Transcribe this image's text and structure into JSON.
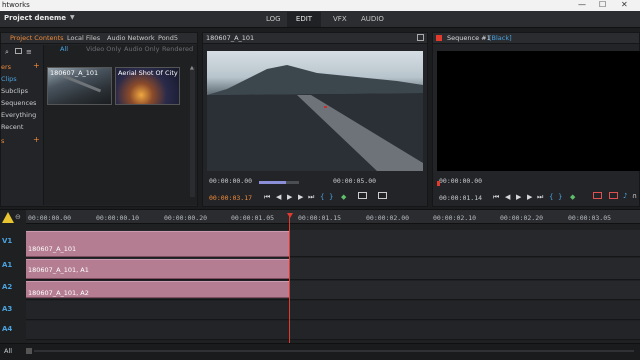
{
  "window": {
    "title": "htworks",
    "controls": [
      "—",
      "☐",
      "✕"
    ]
  },
  "menubar": {
    "project": "Project deneme",
    "project_dropdown": "▼",
    "tabs": [
      {
        "label": "LOG"
      },
      {
        "label": "EDIT"
      },
      {
        "label": "VFX"
      },
      {
        "label": "AUDIO"
      }
    ],
    "active_tab": "EDIT"
  },
  "project_panel": {
    "tabs": [
      {
        "label": "Project Contents"
      },
      {
        "label": "Local Files"
      },
      {
        "label": "Audio Network"
      },
      {
        "label": "Pond5"
      }
    ],
    "sidebar": [
      {
        "label": "ers",
        "plus": "+"
      },
      {
        "label": "Clips"
      },
      {
        "label": "Subclips"
      },
      {
        "label": "Sequences"
      },
      {
        "label": "Everything"
      },
      {
        "label": "Recent"
      },
      {
        "label": "s",
        "plus": "+"
      }
    ],
    "filters": [
      {
        "label": "All"
      },
      {
        "label": "Video Only"
      },
      {
        "label": "Audio Only"
      },
      {
        "label": "Rendered"
      }
    ],
    "thumbs": [
      {
        "label": "180607_A_101"
      },
      {
        "label": "Aerial Shot Of City"
      }
    ]
  },
  "source_viewer": {
    "title": "180607_A_101",
    "tc_in": "00:00:00.00",
    "tc_out": "00:00:05.00",
    "tc_current": "00:00:03.17",
    "playhead_position": 0.68
  },
  "sequence_viewer": {
    "title": "Sequence #1",
    "subtitle": "[Black]",
    "tc_in": "00:00:00.00",
    "tc_current": "00:00:01.14"
  },
  "timeline": {
    "ruler": [
      "00:00:00.00",
      "00:00:00.10",
      "00:00:00.20",
      "00:00:01.05",
      "00:00:01.15",
      "00:00:02.00",
      "00:00:02.10",
      "00:00:02.20",
      "00:00:03.05"
    ],
    "tracks": [
      "V1",
      "A1",
      "A2",
      "A3",
      "A4"
    ],
    "clips": [
      {
        "track": "V1",
        "label": "180607_A_101"
      },
      {
        "track": "A1",
        "label": "180607_A_101, A1"
      },
      {
        "track": "A2",
        "label": "180607_A_101, A2"
      }
    ],
    "playhead_time": "00:00:01.14",
    "footer_label": "All"
  },
  "colors": {
    "accent_orange": "#f08a3a",
    "accent_blue": "#4aa3e0",
    "clip_pink": "#b57d92",
    "playhead_red": "#e23b2e"
  }
}
